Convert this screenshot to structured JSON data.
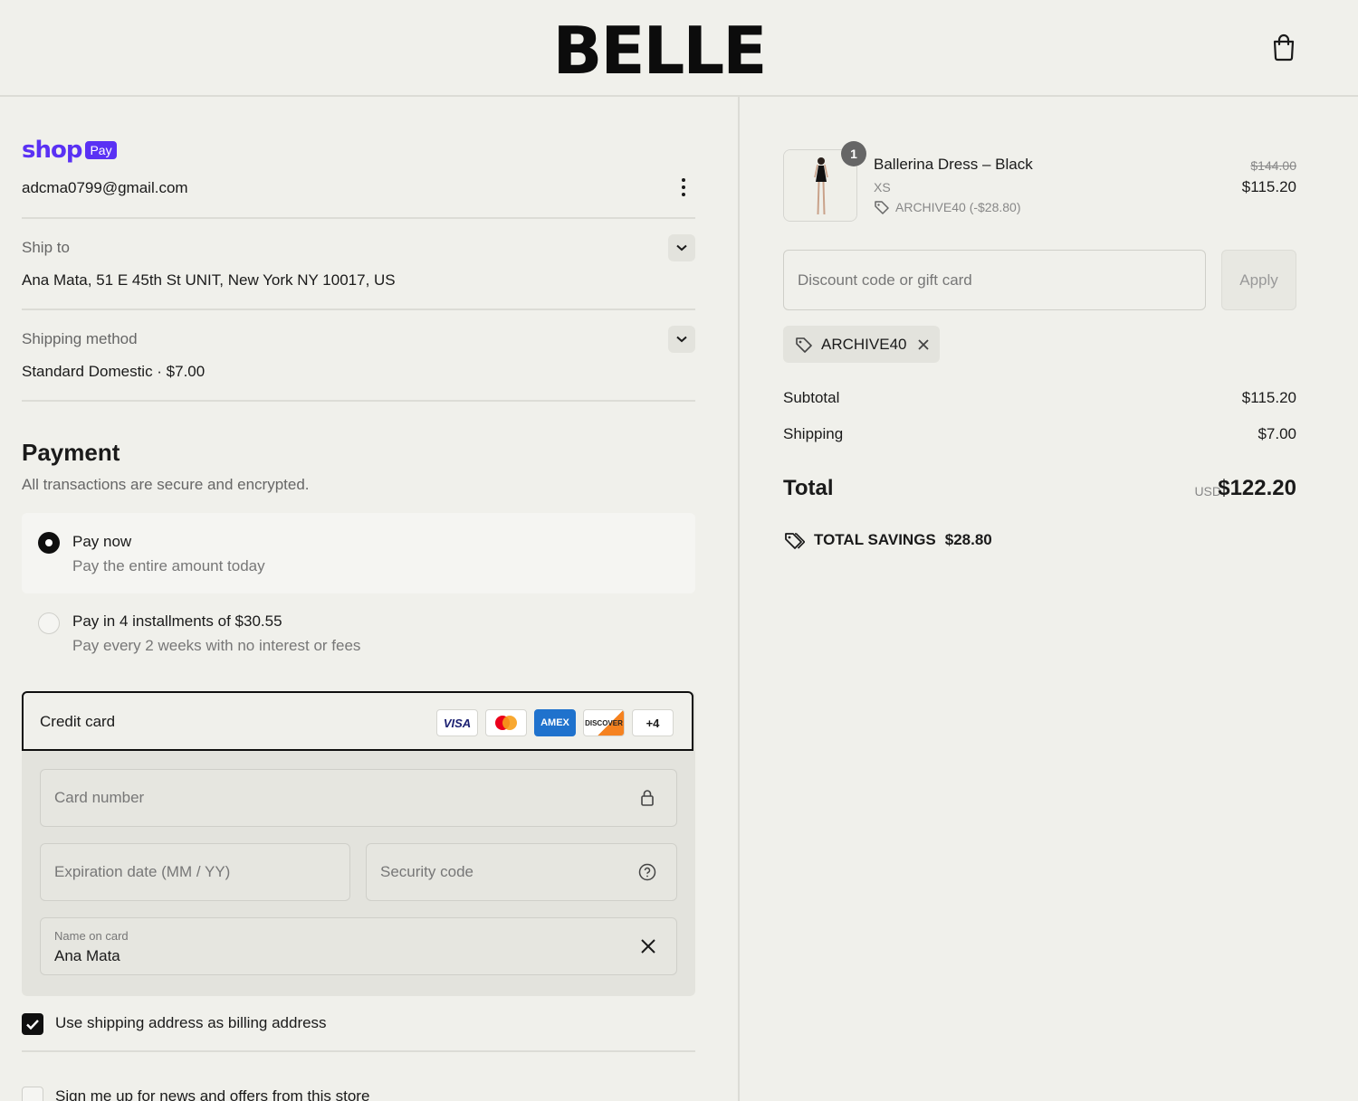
{
  "header": {
    "brand": "BELLE"
  },
  "shop_pay": {
    "word": "shop",
    "badge": "Pay"
  },
  "account": {
    "email": "adcma0799@gmail.com"
  },
  "ship_to": {
    "label": "Ship to",
    "value": "Ana Mata, 51 E 45th St UNIT, New York NY 10017, US"
  },
  "shipping_method": {
    "label": "Shipping method",
    "value": "Standard Domestic · $7.00"
  },
  "payment": {
    "title": "Payment",
    "subtitle": "All transactions are secure and encrypted.",
    "options": [
      {
        "title": "Pay now",
        "subtitle": "Pay the entire amount today",
        "selected": true
      },
      {
        "title": "Pay in 4 installments of $30.55",
        "subtitle": "Pay every 2 weeks with no interest or fees",
        "selected": false
      }
    ],
    "credit_card": {
      "title": "Credit card",
      "brands": [
        "VISA",
        "mastercard",
        "AMEX",
        "DISCOVER",
        "+4"
      ],
      "card_number_placeholder": "Card number",
      "expiration_placeholder": "Expiration date (MM / YY)",
      "security_code_placeholder": "Security code",
      "name_label": "Name on card",
      "name_value": "Ana Mata"
    },
    "billing_checkbox": {
      "label": "Use shipping address as billing address",
      "checked": true
    },
    "newsletter_checkbox": {
      "label": "Sign me up for news and offers from this store",
      "checked": false
    }
  },
  "order": {
    "item": {
      "quantity": "1",
      "name": "Ballerina Dress – Black",
      "variant": "XS",
      "discount": "ARCHIVE40 (-$28.80)",
      "original_price": "$144.00",
      "price": "$115.20"
    },
    "discount_placeholder": "Discount code or gift card",
    "apply_label": "Apply",
    "applied_code": "ARCHIVE40",
    "subtotal_label": "Subtotal",
    "subtotal": "$115.20",
    "shipping_label": "Shipping",
    "shipping": "$7.00",
    "total_label": "Total",
    "currency": "USD",
    "total": "$122.20",
    "savings_label": "TOTAL SAVINGS",
    "savings": "$28.80"
  },
  "colors": {
    "shop_pay": "#5a31f4",
    "background": "#f0f0eb",
    "amex": "#1f72cd"
  }
}
